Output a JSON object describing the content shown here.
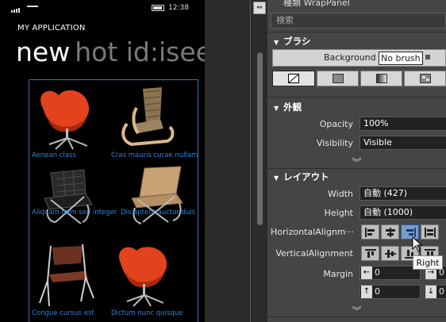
{
  "phone": {
    "status_time": "12:38",
    "app_title": "MY APPLICATION",
    "pivot_active": "new",
    "pivot_inactive": "hot id:isee",
    "items": [
      {
        "caption": "Aenean class",
        "image": "red-swan-chair"
      },
      {
        "caption": "Cras mauris curae nullam",
        "image": "wooden-lounge-chair"
      },
      {
        "caption": "Aliquam nam sed integer",
        "image": "black-leather-chair"
      },
      {
        "caption": "Dis aptent auctor duis",
        "image": "tan-leather-chair"
      },
      {
        "caption": "Congue cursus est",
        "image": "brown-tube-chair"
      },
      {
        "caption": "Dictum nunc quisque",
        "image": "red-swan-chair"
      }
    ]
  },
  "panel": {
    "type_label": "種類 WrapPanel",
    "search_placeholder": "検索",
    "brush": {
      "header": "ブラシ",
      "background_label": "Background",
      "background_value": "No brush"
    },
    "appearance": {
      "header": "外観",
      "opacity_label": "Opacity",
      "opacity_value": "100%",
      "visibility_label": "Visibility",
      "visibility_value": "Visible"
    },
    "layout": {
      "header": "レイアウト",
      "width_label": "Width",
      "width_value": "自動 (427)",
      "height_label": "Height",
      "height_value": "自動 (1000)",
      "halign_label": "HorizontalAlignm···",
      "valign_label": "VerticalAlignment",
      "margin_label": "Margin",
      "margin_values": [
        "0",
        "0",
        "0",
        "0"
      ]
    },
    "tooltip": "Right"
  },
  "colors": {
    "accent": "#2f84d6",
    "phone_bg": "#000000",
    "panel_bg": "#454545",
    "selection_border": "#3a6fb0"
  }
}
